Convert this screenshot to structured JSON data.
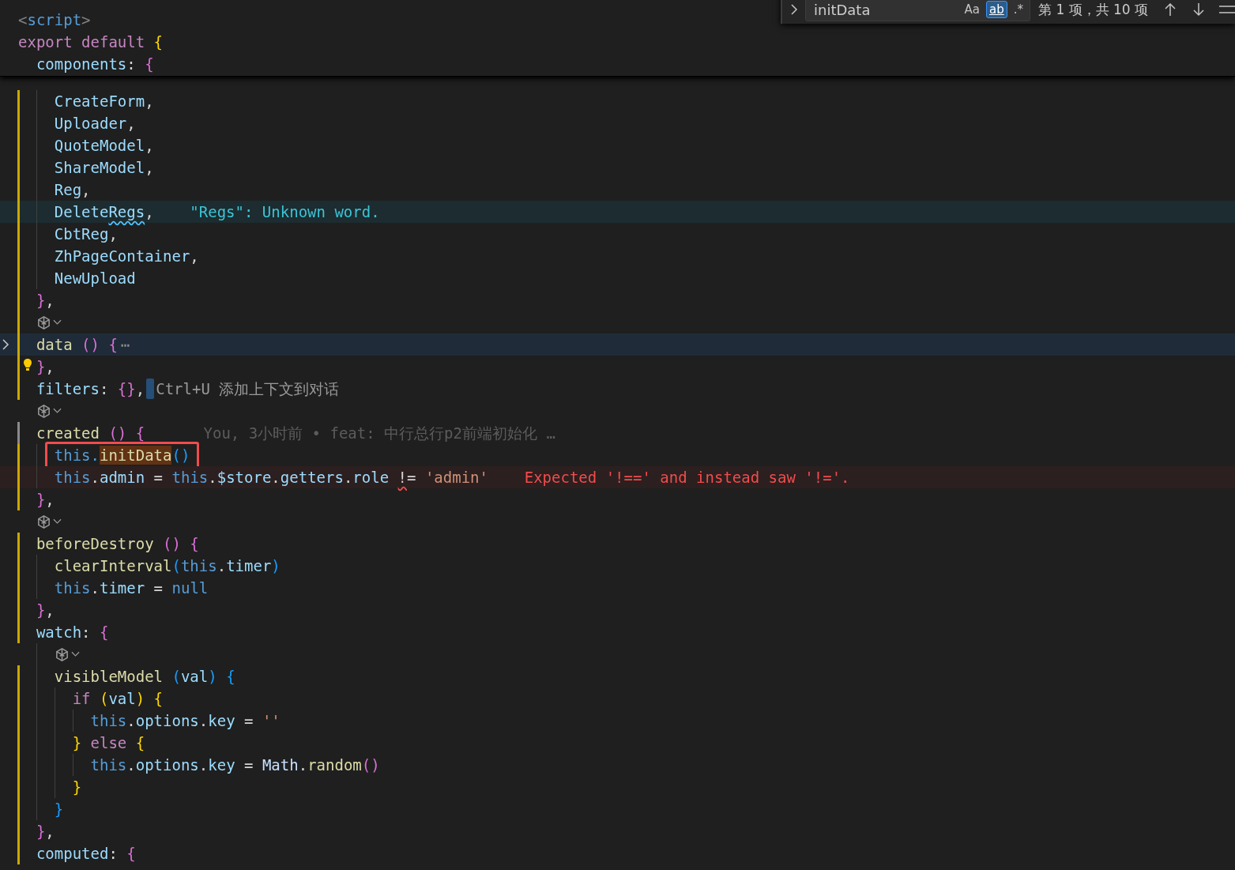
{
  "code": [
    {
      "kind": "code",
      "sticky": true,
      "modified": false,
      "tokens": [
        {
          "text": "<",
          "kind": "tag"
        },
        {
          "text": "script",
          "kind": "tagname"
        },
        {
          "text": ">",
          "kind": "tag"
        }
      ]
    },
    {
      "kind": "code",
      "sticky": true,
      "modified": false,
      "tokens": [
        {
          "text": "export default ",
          "kind": "kw"
        },
        {
          "text": "{",
          "kind": "b1"
        }
      ],
      "children": [
        {
          "kind": "code",
          "sticky": true,
          "modified": false,
          "tokens": [
            {
              "text": "components",
              "kind": "prop"
            },
            {
              "text": ": ",
              "kind": "plain"
            },
            {
              "text": "{",
              "kind": "b2"
            }
          ],
          "children": [
            {
              "kind": "code",
              "modified": true,
              "tokens": [
                {
                  "text": "CreateForm",
                  "kind": "prop"
                },
                {
                  "text": ",",
                  "kind": "plain"
                }
              ]
            },
            {
              "kind": "code",
              "modified": true,
              "tokens": [
                {
                  "text": "Uploader",
                  "kind": "prop"
                },
                {
                  "text": ",",
                  "kind": "plain"
                }
              ]
            },
            {
              "kind": "code",
              "modified": true,
              "tokens": [
                {
                  "text": "QuoteModel",
                  "kind": "prop"
                },
                {
                  "text": ",",
                  "kind": "plain"
                }
              ]
            },
            {
              "kind": "code",
              "modified": true,
              "tokens": [
                {
                  "text": "ShareModel",
                  "kind": "prop"
                },
                {
                  "text": ",",
                  "kind": "plain"
                }
              ]
            },
            {
              "kind": "code",
              "modified": true,
              "tokens": [
                {
                  "text": "Reg",
                  "kind": "prop"
                },
                {
                  "text": ",",
                  "kind": "plain"
                }
              ]
            },
            {
              "kind": "code",
              "modified": true,
              "tokens": [
                {
                  "text": "Delete",
                  "kind": "prop"
                },
                {
                  "text": "Regs",
                  "kind": "prop",
                  "misspelled": true
                },
                {
                  "text": ",",
                  "kind": "plain"
                }
              ],
              "hint": {
                "kind": "spell",
                "text": "\"Regs\": Unknown word."
              }
            },
            {
              "kind": "code",
              "modified": true,
              "tokens": [
                {
                  "text": "CbtReg",
                  "kind": "prop"
                },
                {
                  "text": ",",
                  "kind": "plain"
                }
              ]
            },
            {
              "kind": "code",
              "modified": true,
              "tokens": [
                {
                  "text": "ZhPageContainer",
                  "kind": "prop"
                },
                {
                  "text": ",",
                  "kind": "plain"
                }
              ]
            },
            {
              "kind": "code",
              "modified": true,
              "tokens": [
                {
                  "text": "NewUpload",
                  "kind": "prop"
                }
              ]
            }
          ]
        },
        {
          "kind": "code",
          "modified": true,
          "tokens": [
            {
              "text": "}",
              "kind": "b2"
            },
            {
              "text": ",",
              "kind": "plain"
            }
          ]
        },
        {
          "kind": "codelens",
          "modified": true
        },
        {
          "kind": "code",
          "modified": true,
          "folded": true,
          "tokens": [
            {
              "text": "data ",
              "kind": "fn"
            },
            {
              "text": "() {",
              "kind": "b2"
            },
            {
              "text": "⋯",
              "kind": "fold"
            }
          ]
        },
        {
          "kind": "code",
          "modified": true,
          "lightbulb": true,
          "tokens": [
            {
              "text": "}",
              "kind": "b2"
            },
            {
              "text": ",",
              "kind": "plain"
            }
          ]
        },
        {
          "kind": "code",
          "modified": true,
          "tokens": [
            {
              "text": "filters",
              "kind": "prop"
            },
            {
              "text": ": ",
              "kind": "plain"
            },
            {
              "text": "{}",
              "kind": "b2"
            },
            {
              "text": ",",
              "kind": "plain"
            }
          ],
          "hint": {
            "kind": "chat",
            "text": "Ctrl+U 添加上下文到对话"
          }
        },
        {
          "kind": "codelens",
          "modified": false
        },
        {
          "kind": "code",
          "modified": false,
          "current_scope": true,
          "tokens": [
            {
              "text": "created ",
              "kind": "fn"
            },
            {
              "text": "() {",
              "kind": "b2"
            }
          ],
          "hint": {
            "kind": "blame",
            "text": "You, 3小时前 • feat: 中行总行p2前端初始化 …"
          },
          "children": [
            {
              "kind": "code",
              "modified": true,
              "outlined": true,
              "tokens": [
                {
                  "text": "this.",
                  "kind": "this"
                },
                {
                  "text": "initData",
                  "kind": "fn",
                  "match": true
                },
                {
                  "text": "()",
                  "kind": "b3"
                }
              ]
            },
            {
              "kind": "code",
              "modified": true,
              "tokens": [
                {
                  "text": "this",
                  "kind": "this"
                },
                {
                  "text": ".",
                  "kind": "plain"
                },
                {
                  "text": "admin",
                  "kind": "prop"
                },
                {
                  "text": " = ",
                  "kind": "plain"
                },
                {
                  "text": "this",
                  "kind": "this"
                },
                {
                  "text": ".",
                  "kind": "plain"
                },
                {
                  "text": "$store",
                  "kind": "prop"
                },
                {
                  "text": ".",
                  "kind": "plain"
                },
                {
                  "text": "getters",
                  "kind": "prop"
                },
                {
                  "text": ".",
                  "kind": "plain"
                },
                {
                  "text": "role ",
                  "kind": "prop"
                },
                {
                  "text": "!",
                  "kind": "plain",
                  "flagged": true
                },
                {
                  "text": "= ",
                  "kind": "plain"
                },
                {
                  "text": "'admin'",
                  "kind": "str"
                }
              ],
              "hint": {
                "kind": "error",
                "text": "Expected '!==' and instead saw '!='."
              }
            }
          ]
        },
        {
          "kind": "code",
          "modified": true,
          "tokens": [
            {
              "text": "}",
              "kind": "b2"
            },
            {
              "text": ",",
              "kind": "plain"
            }
          ]
        },
        {
          "kind": "codelens",
          "modified": false
        },
        {
          "kind": "code",
          "modified": true,
          "tokens": [
            {
              "text": "beforeDestroy ",
              "kind": "fn"
            },
            {
              "text": "() {",
              "kind": "b2"
            }
          ],
          "children": [
            {
              "kind": "code",
              "modified": true,
              "tokens": [
                {
                  "text": "clearInterval",
                  "kind": "fn"
                },
                {
                  "text": "(",
                  "kind": "b3"
                },
                {
                  "text": "this",
                  "kind": "this"
                },
                {
                  "text": ".",
                  "kind": "plain"
                },
                {
                  "text": "timer",
                  "kind": "prop"
                },
                {
                  "text": ")",
                  "kind": "b3"
                }
              ]
            },
            {
              "kind": "code",
              "modified": true,
              "tokens": [
                {
                  "text": "this",
                  "kind": "this"
                },
                {
                  "text": ".",
                  "kind": "plain"
                },
                {
                  "text": "timer",
                  "kind": "prop"
                },
                {
                  "text": " = ",
                  "kind": "plain"
                },
                {
                  "text": "null",
                  "kind": "this"
                }
              ]
            }
          ]
        },
        {
          "kind": "code",
          "modified": true,
          "tokens": [
            {
              "text": "}",
              "kind": "b2"
            },
            {
              "text": ",",
              "kind": "plain"
            }
          ]
        },
        {
          "kind": "code",
          "modified": true,
          "tokens": [
            {
              "text": "watch",
              "kind": "prop"
            },
            {
              "text": ": ",
              "kind": "plain"
            },
            {
              "text": "{",
              "kind": "b2"
            }
          ],
          "children": [
            {
              "kind": "codelens",
              "modified": false
            },
            {
              "kind": "code",
              "modified": true,
              "tokens": [
                {
                  "text": "visibleModel ",
                  "kind": "fn"
                },
                {
                  "text": "(",
                  "kind": "b3"
                },
                {
                  "text": "val",
                  "kind": "prop"
                },
                {
                  "text": ") {",
                  "kind": "b3"
                }
              ],
              "children": [
                {
                  "kind": "code",
                  "modified": true,
                  "tokens": [
                    {
                      "text": "if ",
                      "kind": "kw"
                    },
                    {
                      "text": "(",
                      "kind": "b1"
                    },
                    {
                      "text": "val",
                      "kind": "prop"
                    },
                    {
                      "text": ") {",
                      "kind": "b1"
                    }
                  ],
                  "children": [
                    {
                      "kind": "code",
                      "modified": true,
                      "tokens": [
                        {
                          "text": "this",
                          "kind": "this"
                        },
                        {
                          "text": ".",
                          "kind": "plain"
                        },
                        {
                          "text": "options",
                          "kind": "prop"
                        },
                        {
                          "text": ".",
                          "kind": "plain"
                        },
                        {
                          "text": "key",
                          "kind": "prop"
                        },
                        {
                          "text": " = ",
                          "kind": "plain"
                        },
                        {
                          "text": "''",
                          "kind": "str"
                        }
                      ]
                    }
                  ]
                },
                {
                  "kind": "code",
                  "modified": true,
                  "tokens": [
                    {
                      "text": "} ",
                      "kind": "b1"
                    },
                    {
                      "text": "else ",
                      "kind": "kw"
                    },
                    {
                      "text": "{",
                      "kind": "b1"
                    }
                  ],
                  "children": [
                    {
                      "kind": "code",
                      "modified": true,
                      "tokens": [
                        {
                          "text": "this",
                          "kind": "this"
                        },
                        {
                          "text": ".",
                          "kind": "plain"
                        },
                        {
                          "text": "options",
                          "kind": "prop"
                        },
                        {
                          "text": ".",
                          "kind": "plain"
                        },
                        {
                          "text": "key",
                          "kind": "prop"
                        },
                        {
                          "text": " = ",
                          "kind": "plain"
                        },
                        {
                          "text": "Math",
                          "kind": "cls"
                        },
                        {
                          "text": ".",
                          "kind": "plain"
                        },
                        {
                          "text": "random",
                          "kind": "fn"
                        },
                        {
                          "text": "()",
                          "kind": "b2"
                        }
                      ]
                    }
                  ]
                },
                {
                  "kind": "code",
                  "modified": true,
                  "tokens": [
                    {
                      "text": "}",
                      "kind": "b1"
                    }
                  ]
                }
              ]
            },
            {
              "kind": "code",
              "modified": true,
              "tokens": [
                {
                  "text": "}",
                  "kind": "b3"
                }
              ]
            }
          ]
        },
        {
          "kind": "code",
          "modified": true,
          "tokens": [
            {
              "text": "}",
              "kind": "b2"
            },
            {
              "text": ",",
              "kind": "plain"
            }
          ]
        },
        {
          "kind": "code",
          "modified": true,
          "tokens": [
            {
              "text": "computed",
              "kind": "prop"
            },
            {
              "text": ": ",
              "kind": "plain"
            },
            {
              "text": "{",
              "kind": "b2"
            }
          ]
        }
      ]
    }
  ],
  "find_widget": {
    "value": "initData",
    "toggles": [
      {
        "label": "Aa",
        "selected": false
      },
      {
        "label": "ab",
        "selected": true
      },
      {
        "label": ".*",
        "selected": false
      }
    ],
    "result": "第 1 项，共 10 项"
  }
}
